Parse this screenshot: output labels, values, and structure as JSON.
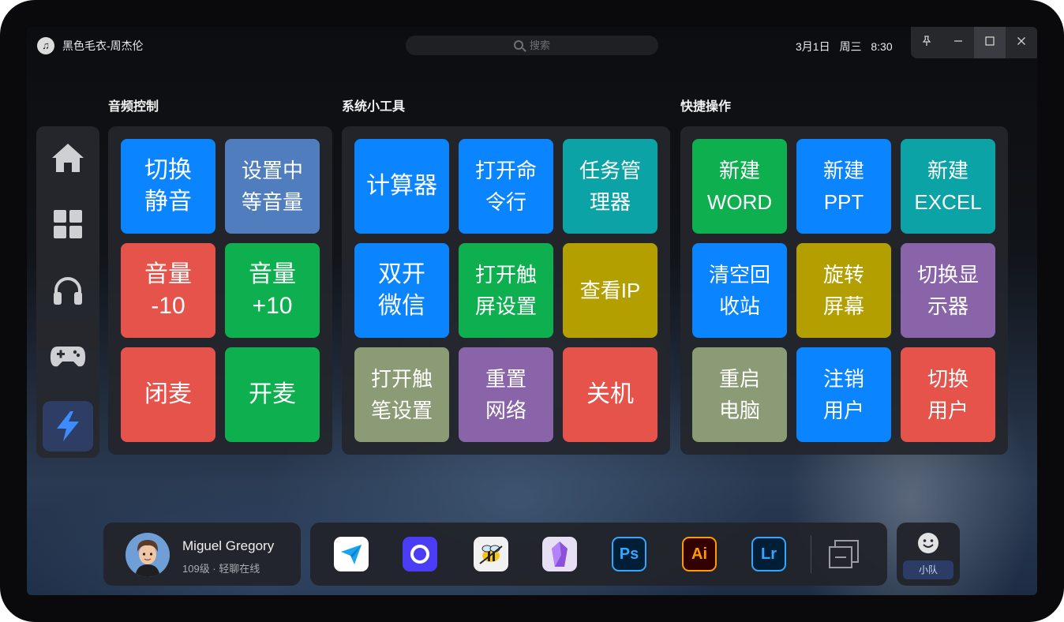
{
  "titlebar": {
    "song": "黑色毛衣-周杰伦",
    "search_placeholder": "搜索",
    "date": "3月1日",
    "weekday": "周三",
    "time": "8:30",
    "pin_icon": "pin-icon",
    "controls": [
      "minimize-icon",
      "maximize-icon",
      "close-icon"
    ]
  },
  "sidebar": {
    "items": [
      {
        "icon": "home-icon"
      },
      {
        "icon": "grid-icon"
      },
      {
        "icon": "headphones-icon"
      },
      {
        "icon": "gamepad-icon"
      },
      {
        "icon": "lightning-icon",
        "active": true
      }
    ]
  },
  "sections": [
    {
      "title": "音频控制",
      "tiles": [
        {
          "label": "切换\n静音",
          "color": "#0a84ff"
        },
        {
          "label": "设置中\n等音量",
          "color": "#4f7dbd"
        },
        {
          "label": "音量\n-10",
          "color": "#e5534b"
        },
        {
          "label": "音量\n+10",
          "color": "#0eaf4f"
        },
        {
          "label": "闭麦",
          "color": "#e5534b"
        },
        {
          "label": "开麦",
          "color": "#0eaf4f"
        }
      ]
    },
    {
      "title": "系统小工具",
      "tiles": [
        {
          "label": "计算器",
          "color": "#0a84ff"
        },
        {
          "label": "打开命\n令行",
          "color": "#0a84ff"
        },
        {
          "label": "任务管\n理器",
          "color": "#0ba3a6"
        },
        {
          "label": "双开\n微信",
          "color": "#0a84ff"
        },
        {
          "label": "打开触\n屏设置",
          "color": "#0eaf4f"
        },
        {
          "label": "查看IP",
          "color": "#b3a000"
        },
        {
          "label": "打开触\n笔设置",
          "color": "#8a9b75"
        },
        {
          "label": "重置\n网络",
          "color": "#8a64a8"
        },
        {
          "label": "关机",
          "color": "#e5534b"
        }
      ]
    },
    {
      "title": "快捷操作",
      "tiles": [
        {
          "label": "新建\nWORD",
          "color": "#0eaf4f"
        },
        {
          "label": "新建\nPPT",
          "color": "#0a84ff"
        },
        {
          "label": "新建\nEXCEL",
          "color": "#0ba3a6"
        },
        {
          "label": "清空回\n收站",
          "color": "#0a84ff"
        },
        {
          "label": "旋转\n屏幕",
          "color": "#b3a000"
        },
        {
          "label": "切换显\n示器",
          "color": "#8a64a8"
        },
        {
          "label": "重启\n电脑",
          "color": "#8a9b75"
        },
        {
          "label": "注销\n用户",
          "color": "#0a84ff"
        },
        {
          "label": "切换\n用户",
          "color": "#e5534b"
        }
      ]
    }
  ],
  "user": {
    "name": "Miguel Gregory",
    "status": "109级 · 轻聊在线"
  },
  "dock": {
    "apps": [
      {
        "icon": "paper-plane-icon",
        "bg": "#ffffff"
      },
      {
        "icon": "ring-app-icon",
        "bg": "#4b3cf5"
      },
      {
        "icon": "bee-icon",
        "bg": "#f1f1f1"
      },
      {
        "icon": "crystal-icon",
        "bg": "#e7dff3"
      },
      {
        "icon": "photoshop-icon",
        "text": "Ps",
        "bg": "#001e36",
        "fg": "#31a8ff"
      },
      {
        "icon": "illustrator-icon",
        "text": "Ai",
        "bg": "#330000",
        "fg": "#ff9a00"
      },
      {
        "icon": "lightroom-icon",
        "text": "Lr",
        "bg": "#001e36",
        "fg": "#31a8ff"
      }
    ],
    "extra_icon": "window-stack-icon"
  },
  "team": {
    "icon": "smiley-icon",
    "label": "小队"
  }
}
